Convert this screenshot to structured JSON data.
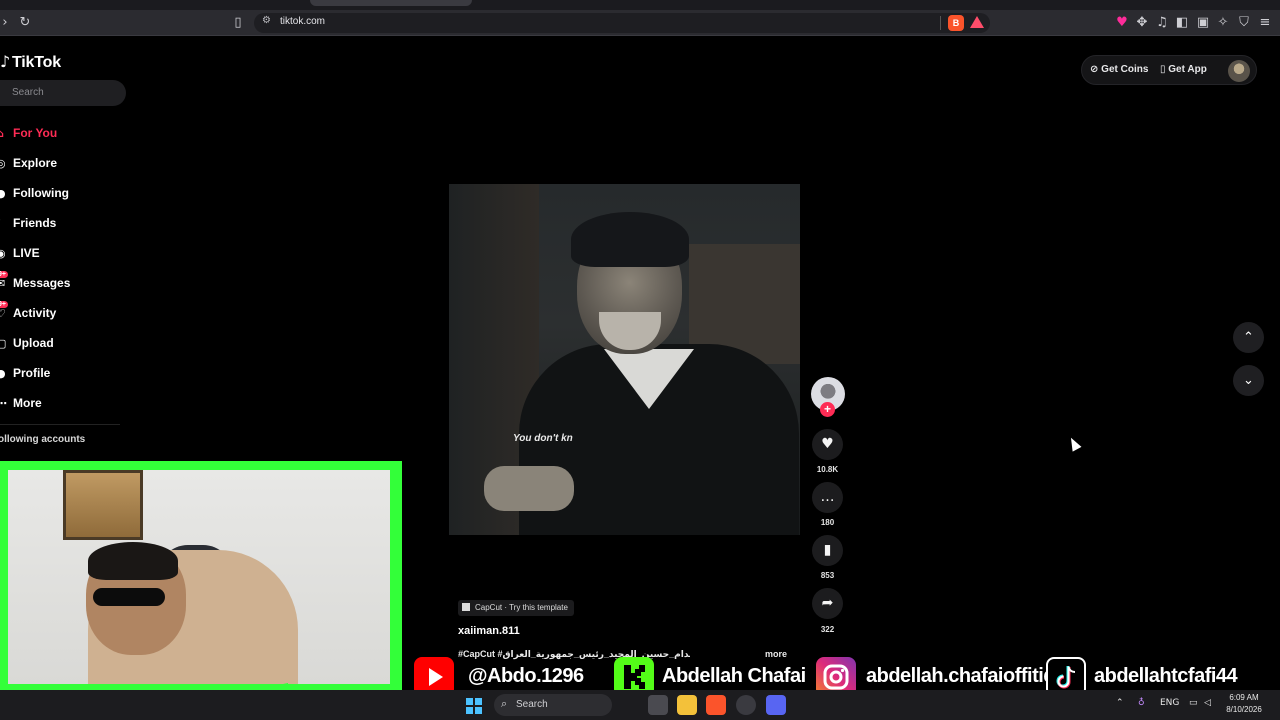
{
  "browser": {
    "url": "tiktok.com",
    "nav_icons": [
      "forward-icon",
      "reload-icon",
      "bookmark-icon",
      "site-settings-icon"
    ],
    "extension_icons": [
      "brave-shields-icon",
      "brave-rewards-icon",
      "vpn-icon",
      "extensions-icon",
      "media-icon",
      "sidebar-icon",
      "wallet-icon",
      "leo-icon",
      "vpn-shield-icon",
      "menu-icon"
    ]
  },
  "tiktok": {
    "logo_text": "TikTok",
    "search_placeholder": "Search",
    "nav": [
      {
        "label": "For You",
        "icon": "home-icon",
        "active": true
      },
      {
        "label": "Explore",
        "icon": "compass-icon"
      },
      {
        "label": "Following",
        "icon": "following-icon"
      },
      {
        "label": "Friends",
        "icon": "friends-icon"
      },
      {
        "label": "LIVE",
        "icon": "live-icon"
      },
      {
        "label": "Messages",
        "icon": "messages-icon",
        "badge": "9+"
      },
      {
        "label": "Activity",
        "icon": "activity-icon",
        "badge": "9+"
      },
      {
        "label": "Upload",
        "icon": "upload-icon"
      },
      {
        "label": "Profile",
        "icon": "profile-icon"
      },
      {
        "label": "More",
        "icon": "more-icon"
      }
    ],
    "following_accounts_label": "ollowing accounts",
    "get_coins": "Get Coins",
    "get_app": "Get App",
    "video": {
      "caption": "You don't kn",
      "capcut_label": "CapCut · Try this template",
      "author": "xaiiman.811",
      "description": "#CapCut #صدام_حسين_المجيد_رئيس_جمهورية_العراق ...",
      "more": "more"
    },
    "actions": {
      "likes": "10.8K",
      "comments": "180",
      "saves": "853",
      "shares": "322"
    }
  },
  "overlay": {
    "youtube": "@Abdo.1296",
    "kick": "Abdellah Chafai",
    "instagram": "abdellah.chafaioffitid",
    "tiktok": "abdellahtcfafi44"
  },
  "taskbar": {
    "search_placeholder": "Search",
    "language": "ENG",
    "time": "6:09 AM",
    "date": "8/10/2026"
  },
  "colors": {
    "tiktok_red": "#fe2c55",
    "webcam_frame": "#33ff39",
    "background": "#000000"
  }
}
